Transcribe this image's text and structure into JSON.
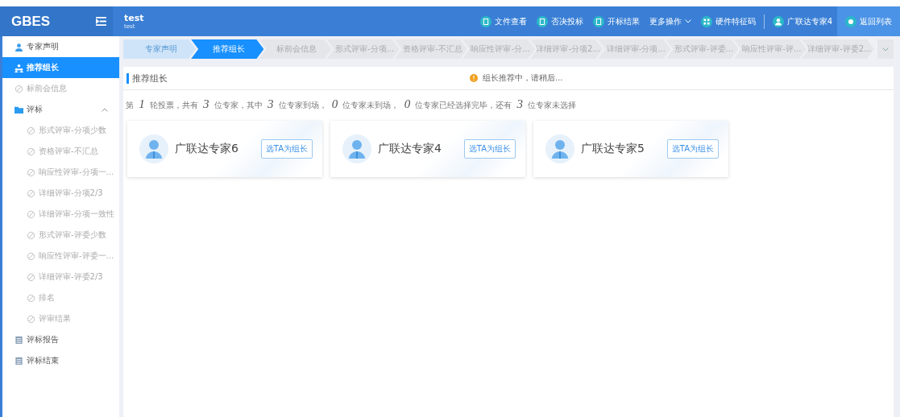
{
  "app": {
    "logo": "GBES",
    "project_title": "test",
    "project_subtitle": "test"
  },
  "toolbar": [
    {
      "kind": "file",
      "label": "文件查看"
    },
    {
      "kind": "reject",
      "label": "否决投标"
    },
    {
      "kind": "result",
      "label": "开标结果"
    },
    {
      "kind": "more",
      "label": "更多操作"
    },
    {
      "kind": "hardware",
      "label": "硬件特征码"
    },
    {
      "kind": "user",
      "label": "广联达专家4"
    },
    {
      "kind": "back",
      "label": "返回列表"
    }
  ],
  "sidebar": {
    "items": [
      {
        "kind": "person",
        "label": "专家声明",
        "selected": false
      },
      {
        "kind": "group",
        "label": "推荐组长",
        "selected": true
      },
      {
        "kind": "pending",
        "label": "标前会信息",
        "selected": false
      },
      {
        "kind": "folder",
        "label": "评标",
        "selected": false,
        "expanded": true,
        "children": [
          {
            "kind": "pending",
            "label": "形式评审-分项少数",
            "selected": false
          },
          {
            "kind": "pending",
            "label": "资格评审-不汇总",
            "selected": false
          },
          {
            "kind": "pending",
            "label": "响应性评审-分项一...",
            "selected": false
          },
          {
            "kind": "pending",
            "label": "详细评审-分项2/3",
            "selected": false
          },
          {
            "kind": "pending",
            "label": "详细评审-分项一致性",
            "selected": false
          },
          {
            "kind": "pending",
            "label": "形式评审-评委少数",
            "selected": false
          },
          {
            "kind": "pending",
            "label": "响应性评审-评委一...",
            "selected": false
          },
          {
            "kind": "pending",
            "label": "详细评审-评委2/3",
            "selected": false
          },
          {
            "kind": "pending",
            "label": "排名",
            "selected": false
          },
          {
            "kind": "pending",
            "label": "评审结果",
            "selected": false
          }
        ]
      },
      {
        "kind": "report",
        "label": "评标报告",
        "selected": false
      },
      {
        "kind": "report",
        "label": "评标结束",
        "selected": false
      }
    ]
  },
  "steps": [
    {
      "label": "专家声明",
      "done": true,
      "selected": false
    },
    {
      "label": "推荐组长",
      "done": false,
      "selected": true
    },
    {
      "label": "标前会信息",
      "done": false,
      "selected": false
    },
    {
      "label": "形式评审-分项...",
      "done": false,
      "selected": false
    },
    {
      "label": "资格评审-不汇总",
      "done": false,
      "selected": false
    },
    {
      "label": "响应性评审-分...",
      "done": false,
      "selected": false
    },
    {
      "label": "详细评审-分项2...",
      "done": false,
      "selected": false
    },
    {
      "label": "详细评审-分项...",
      "done": false,
      "selected": false
    },
    {
      "label": "形式评审-评委...",
      "done": false,
      "selected": false
    },
    {
      "label": "响应性评审-评...",
      "done": false,
      "selected": false
    },
    {
      "label": "详细评审-评委2...",
      "done": false,
      "selected": false
    }
  ],
  "panel": {
    "title": "推荐组长",
    "notice": "组长推荐中，请稍后...",
    "summary": "第 *1* 轮投票，共有 *3* 位专家，其中 *3* 位专家到场， *0* 位专家未到场， *0* 位专家已经选择完毕，还有 *3* 位专家未选择",
    "experts": [
      {
        "name": "广联达专家6",
        "action": "选TA为组长"
      },
      {
        "name": "广联达专家4",
        "action": "选TA为组长"
      },
      {
        "name": "广联达专家5",
        "action": "选TA为组长"
      }
    ]
  }
}
